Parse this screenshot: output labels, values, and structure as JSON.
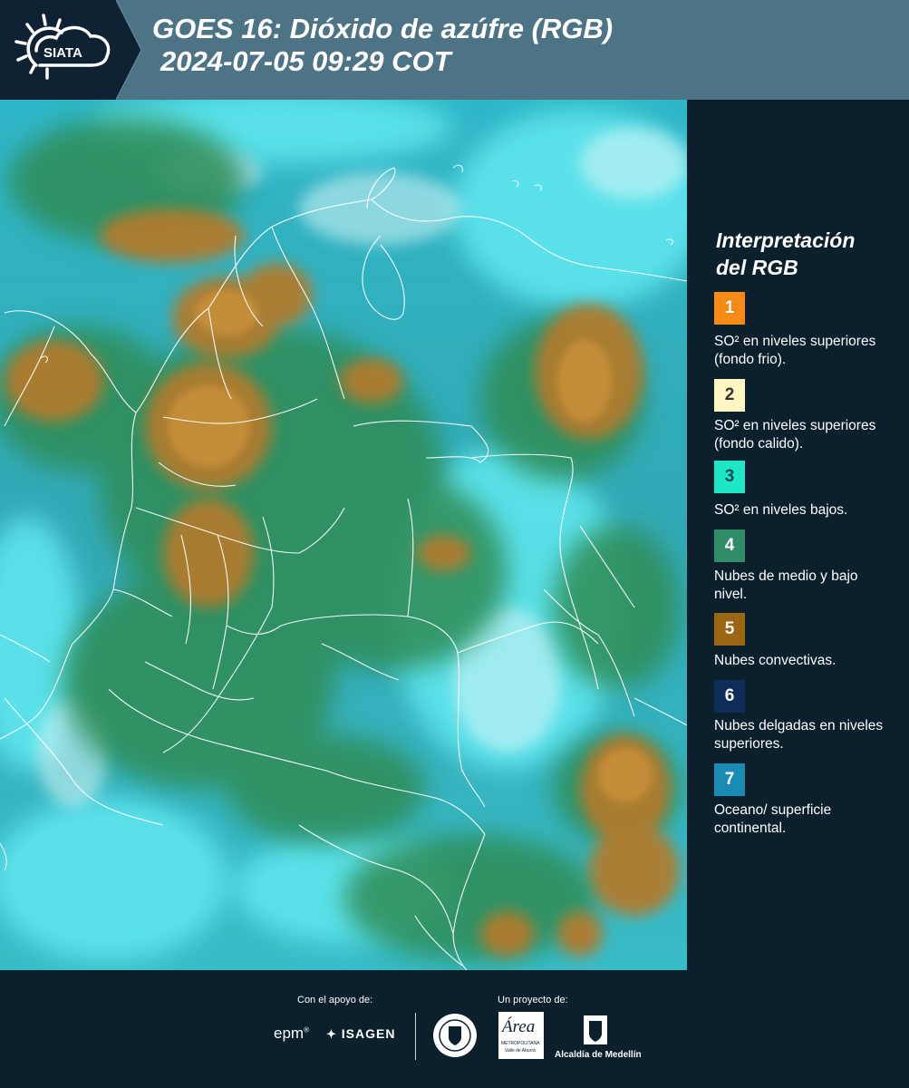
{
  "header": {
    "logo_text": "SIATA",
    "title_line1": "GOES 16: Dióxido de azúfre (RGB)",
    "title_line2": "2024-07-05 09:29 COT"
  },
  "legend": {
    "title_line1": "Interpretación",
    "title_line2": "del RGB",
    "items": [
      {
        "number": "1",
        "color": "#f98a16",
        "text_color": "#ffffff",
        "label": "SO² en niveles superiores (fondo frio)."
      },
      {
        "number": "2",
        "color": "#fff6c4",
        "text_color": "#333333",
        "label": "SO² en niveles superiores (fondo calido)."
      },
      {
        "number": "3",
        "color": "#1de7c4",
        "text_color": "#0b4a56",
        "label": "SO² en niveles bajos."
      },
      {
        "number": "4",
        "color": "#2f8c66",
        "text_color": "#ffffff",
        "label": "Nubes de medio y bajo nivel."
      },
      {
        "number": "5",
        "color": "#9a6614",
        "text_color": "#ffffff",
        "label": "Nubes convectivas."
      },
      {
        "number": "6",
        "color": "#0f2d5a",
        "text_color": "#ffffff",
        "label": "Nubes delgadas en niveles superiores."
      },
      {
        "number": "7",
        "color": "#1a8bb5",
        "text_color": "#ffffff",
        "label": "Oceano/ superficie continental."
      }
    ]
  },
  "footer": {
    "support_label": "Con el apoyo de:",
    "project_label": "Un proyecto de:",
    "partners": {
      "epm": "epm",
      "isagen": "ISAGEN",
      "metro": "Área",
      "metro_sub1": "METROPOLITANA",
      "metro_sub2": "Valle de Aburrá",
      "alcaldia": "Alcaldía de Medellín"
    }
  }
}
